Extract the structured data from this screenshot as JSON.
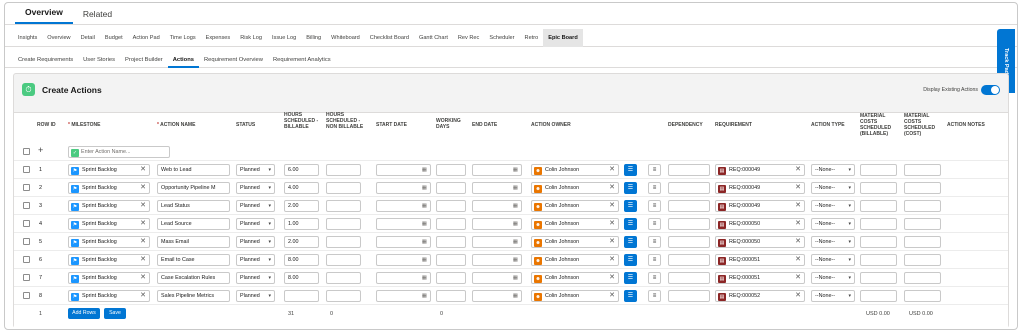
{
  "toptabs": [
    "Overview",
    "Related"
  ],
  "navtabs": [
    "Insights",
    "Overview",
    "Detail",
    "Budget",
    "Action Pad",
    "Time Logs",
    "Expenses",
    "Risk Log",
    "Issue Log",
    "Billing",
    "Whiteboard",
    "Checklist Board",
    "Gantt Chart",
    "Rev Rec",
    "Scheduler",
    "Retro",
    "Epic Board"
  ],
  "subtabs": [
    "Create Requirements",
    "User Stories",
    "Project Builder",
    "Actions",
    "Requirement Overview",
    "Requirement Analytics"
  ],
  "trackpad": "Track Pad",
  "panel": {
    "title": "Create Actions",
    "toggle_label": "Display Existing Actions"
  },
  "headers": {
    "row_id": "ROW ID",
    "milestone": "MILESTONE",
    "action_name": "ACTION NAME",
    "status": "STATUS",
    "hours_billable": "HOURS SCHEDULED - BILLABLE",
    "hours_non_billable": "HOURS SCHEDULED - NON BILLABLE",
    "start_date": "START DATE",
    "working_days": "WORKING DAYS",
    "end_date": "END DATE",
    "action_owner": "ACTION OWNER",
    "dependency": "DEPENDENCY",
    "requirement": "REQUIREMENT",
    "action_type": "ACTION TYPE",
    "material_billable": "MATERIAL COSTS SCHEDULED (BILLABLE)",
    "material_cost": "MATERIAL COSTS SCHEDULED (COST)",
    "action_notes": "ACTION NOTES"
  },
  "new_row": {
    "add_icon": "+",
    "action_name_placeholder": "Enter Action Name..."
  },
  "rows": [
    {
      "id": "1",
      "milestone": "Sprint Backlog",
      "action": "Web to Lead",
      "status": "Planned",
      "hours": "6.00",
      "owner": "Colin Johnson",
      "requirement": "REQ:000049",
      "type": "--None--"
    },
    {
      "id": "2",
      "milestone": "Sprint Backlog",
      "action": "Opportunity Pipeline M",
      "status": "Planned",
      "hours": "4.00",
      "owner": "Colin Johnson",
      "requirement": "REQ:000049",
      "type": "--None--"
    },
    {
      "id": "3",
      "milestone": "Sprint Backlog",
      "action": "Lead Status",
      "status": "Planned",
      "hours": "2.00",
      "owner": "Colin Johnson",
      "requirement": "REQ:000049",
      "type": "--None--"
    },
    {
      "id": "4",
      "milestone": "Sprint Backlog",
      "action": "Lead Source",
      "status": "Planned",
      "hours": "1.00",
      "owner": "Colin Johnson",
      "requirement": "REQ:000050",
      "type": "--None--"
    },
    {
      "id": "5",
      "milestone": "Sprint Backlog",
      "action": "Mass Email",
      "status": "Planned",
      "hours": "2.00",
      "owner": "Colin Johnson",
      "requirement": "REQ:000050",
      "type": "--None--"
    },
    {
      "id": "6",
      "milestone": "Sprint Backlog",
      "action": "Email to Case",
      "status": "Planned",
      "hours": "8.00",
      "owner": "Colin Johnson",
      "requirement": "REQ:000051",
      "type": "--None--"
    },
    {
      "id": "7",
      "milestone": "Sprint Backlog",
      "action": "Case Escalation Rules",
      "status": "Planned",
      "hours": "8.00",
      "owner": "Colin Johnson",
      "requirement": "REQ:000051",
      "type": "--None--"
    },
    {
      "id": "8",
      "milestone": "Sprint Backlog",
      "action": "Sales Pipeline Metrics",
      "status": "Planned",
      "hours": "",
      "owner": "Colin Johnson",
      "requirement": "REQ:000052",
      "type": "--None--"
    }
  ],
  "footer": {
    "row_count": "1",
    "add_rows": "Add Rows",
    "save": "Save",
    "hours_total": "31",
    "non_billable_total": "0",
    "working_days_total": "0",
    "material_billable_total": "USD 0.00",
    "material_cost_total": "USD 0.00"
  },
  "icons": {
    "milestone": "milestone-icon",
    "owner": "user-icon",
    "requirement": "requirement-icon",
    "calendar": "calendar-icon",
    "remove": "✕",
    "caret": "▾"
  },
  "colors": {
    "accent": "#0176d3",
    "milestone_icon": "#1b96ff",
    "owner_icon": "#ea7600",
    "requirement_icon": "#8c2626",
    "success": "#4bca81"
  }
}
